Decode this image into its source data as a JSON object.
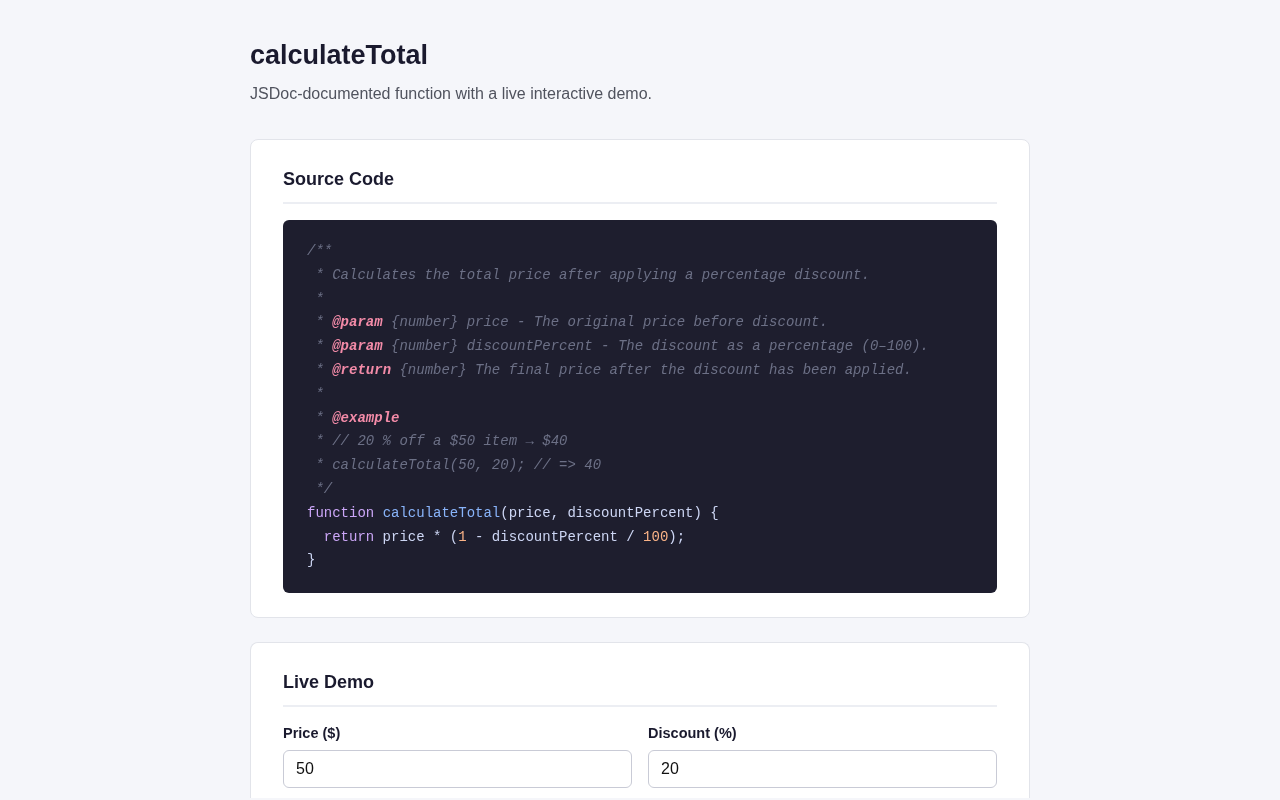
{
  "header": {
    "title": "calculateTotal",
    "subtitle": "JSDoc-documented function with a live interactive demo."
  },
  "sections": [
    {
      "kind": "code",
      "title": "Source Code",
      "lines": [
        {
          "tokens": [
            {
              "kind": "comment",
              "text": "/**"
            }
          ]
        },
        {
          "tokens": [
            {
              "kind": "comment",
              "text": " * Calculates the total price after applying a percentage discount."
            }
          ]
        },
        {
          "tokens": [
            {
              "kind": "comment",
              "text": " *"
            }
          ]
        },
        {
          "tokens": [
            {
              "kind": "comment",
              "text": " * "
            },
            {
              "kind": "tag",
              "text": "@param"
            },
            {
              "kind": "comment",
              "text": " {number} price - The original price before discount."
            }
          ]
        },
        {
          "tokens": [
            {
              "kind": "comment",
              "text": " * "
            },
            {
              "kind": "tag",
              "text": "@param"
            },
            {
              "kind": "comment",
              "text": " {number} discountPercent - The discount as a percentage (0–100)."
            }
          ]
        },
        {
          "tokens": [
            {
              "kind": "comment",
              "text": " * "
            },
            {
              "kind": "tag",
              "text": "@return"
            },
            {
              "kind": "comment",
              "text": " {number} The final price after the discount has been applied."
            }
          ]
        },
        {
          "tokens": [
            {
              "kind": "comment",
              "text": " *"
            }
          ]
        },
        {
          "tokens": [
            {
              "kind": "comment",
              "text": " * "
            },
            {
              "kind": "tag",
              "text": "@example"
            }
          ]
        },
        {
          "tokens": [
            {
              "kind": "comment",
              "text": " * // 20 % off a $50 item → $40"
            }
          ]
        },
        {
          "tokens": [
            {
              "kind": "comment",
              "text": " * calculateTotal(50, 20); // => 40"
            }
          ]
        },
        {
          "tokens": [
            {
              "kind": "comment",
              "text": " */"
            }
          ]
        },
        {
          "tokens": [
            {
              "kind": "keyword",
              "text": "function "
            },
            {
              "kind": "function",
              "text": "calculateTotal"
            },
            {
              "kind": "plain",
              "text": "(price, discountPercent) {"
            }
          ]
        },
        {
          "tokens": [
            {
              "kind": "keyword",
              "text": "  return"
            },
            {
              "kind": "plain",
              "text": " price * ("
            },
            {
              "kind": "number",
              "text": "1"
            },
            {
              "kind": "plain",
              "text": " - discountPercent / "
            },
            {
              "kind": "number",
              "text": "100"
            },
            {
              "kind": "plain",
              "text": ");"
            }
          ]
        },
        {
          "tokens": [
            {
              "kind": "plain",
              "text": "}"
            }
          ]
        }
      ]
    },
    {
      "kind": "demo",
      "title": "Live Demo",
      "fields": [
        {
          "label": "Price ($)",
          "value": "50"
        },
        {
          "label": "Discount (%)",
          "value": "20"
        }
      ]
    }
  ]
}
